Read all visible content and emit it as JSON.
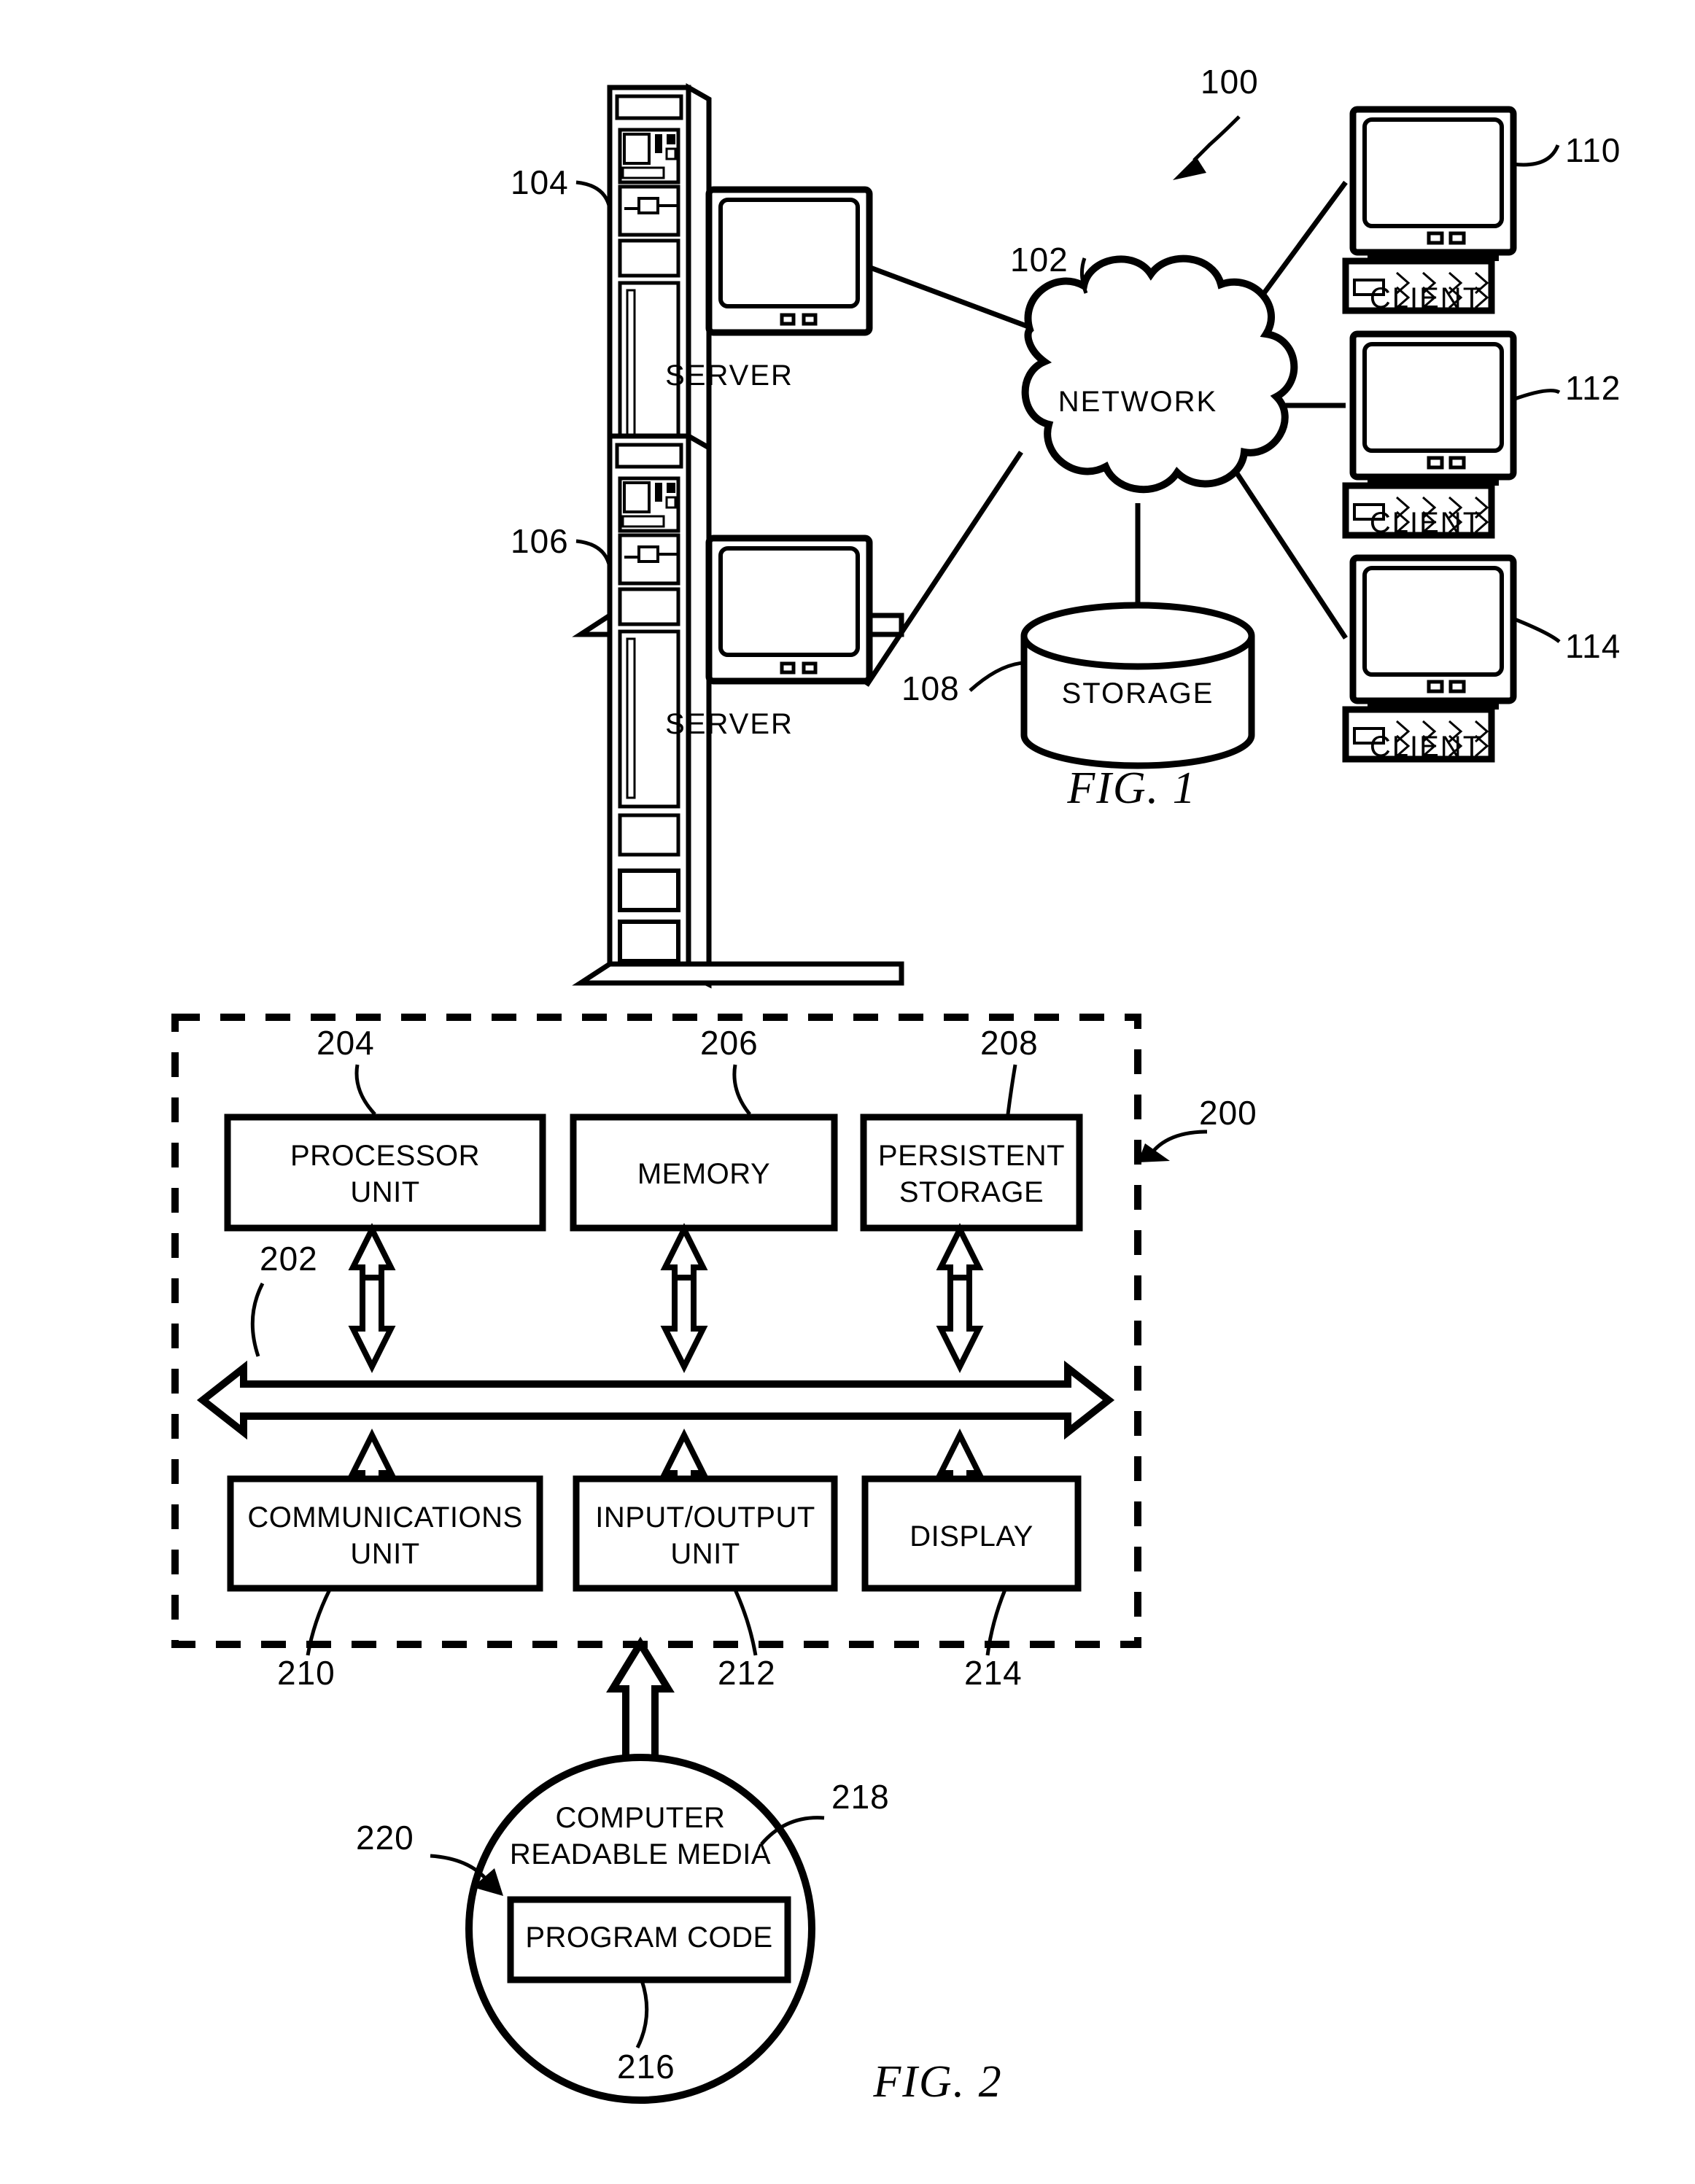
{
  "figure1": {
    "caption": "FIG. 1",
    "system_ref": "100",
    "network": {
      "label": "NETWORK",
      "ref": "102"
    },
    "servers": [
      {
        "label": "SERVER",
        "ref": "104"
      },
      {
        "label": "SERVER",
        "ref": "106"
      }
    ],
    "storage": {
      "label": "STORAGE",
      "ref": "108"
    },
    "clients": [
      {
        "label": "CLIENT",
        "ref": "110"
      },
      {
        "label": "CLIENT",
        "ref": "112"
      },
      {
        "label": "CLIENT",
        "ref": "114"
      }
    ]
  },
  "figure2": {
    "caption": "FIG. 2",
    "data_processing_system_ref": "200",
    "bus_ref": "202",
    "top_blocks": [
      {
        "label": "PROCESSOR\nUNIT",
        "ref": "204"
      },
      {
        "label": "MEMORY",
        "ref": "206"
      },
      {
        "label": "PERSISTENT\nSTORAGE",
        "ref": "208"
      }
    ],
    "bottom_blocks": [
      {
        "label": "COMMUNICATIONS\nUNIT",
        "ref": "210"
      },
      {
        "label": "INPUT/OUTPUT\nUNIT",
        "ref": "212"
      },
      {
        "label": "DISPLAY",
        "ref": "214"
      }
    ],
    "media": {
      "label": "COMPUTER\nREADABLE MEDIA",
      "ref": "218",
      "program_product_ref": "220",
      "program_code": {
        "label": "PROGRAM CODE",
        "ref": "216"
      }
    }
  },
  "colors": {
    "ink": "#000000",
    "paper": "#ffffff"
  }
}
